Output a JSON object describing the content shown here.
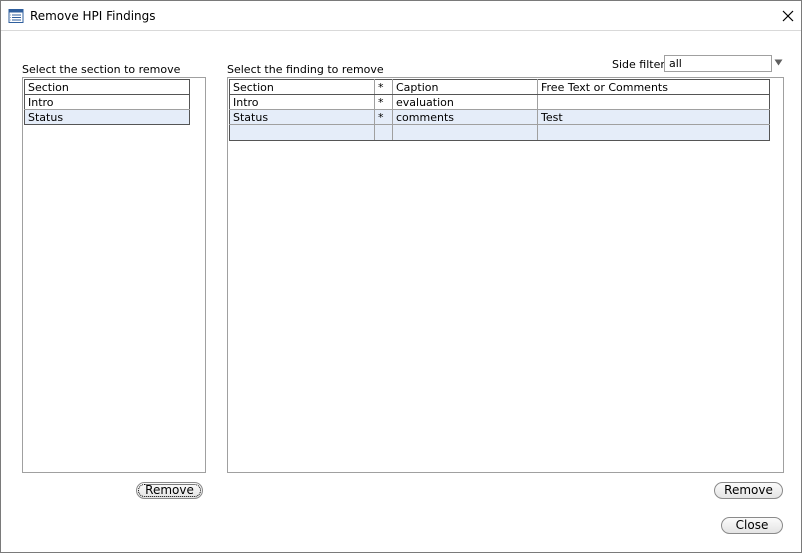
{
  "window": {
    "title": "Remove HPI Findings"
  },
  "left_panel": {
    "label": "Select the section to remove",
    "column_header": "Section",
    "rows": [
      {
        "section": "Intro"
      },
      {
        "section": "Status"
      }
    ],
    "remove_label": "Remove"
  },
  "right_panel": {
    "label": "Select the finding to remove",
    "side_filter_label": "Side filter:",
    "side_filter_value": "all",
    "columns": [
      "Section",
      "*",
      "Caption",
      "Free Text or Comments"
    ],
    "rows": [
      {
        "section": "Intro",
        "star": "*",
        "caption": "evaluation",
        "free_text": ""
      },
      {
        "section": "Status",
        "star": "*",
        "caption": "comments",
        "free_text": "Test"
      }
    ],
    "remove_label": "Remove"
  },
  "footer": {
    "close_label": "Close"
  }
}
